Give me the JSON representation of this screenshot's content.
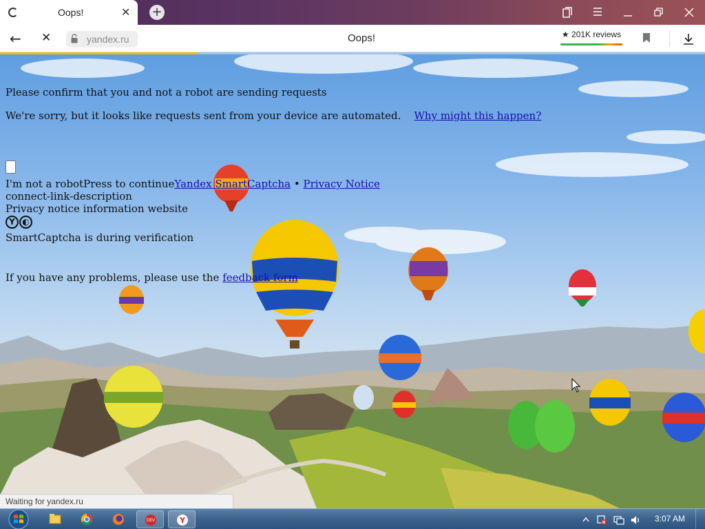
{
  "browser": {
    "tab": {
      "title": "Oops!"
    },
    "address": {
      "url": "yandex.ru"
    },
    "page_title": "Oops!",
    "reviews": {
      "label": "201K reviews",
      "icon": "star-icon"
    },
    "progress": 0.28
  },
  "captcha": {
    "heading": "Please confirm that you and not a robot are sending requests",
    "sorry_text": "We're sorry, but it looks like requests sent from your device are automated.",
    "why_link": "Why might this happen?",
    "checkbox_label": "I'm not a robot",
    "press_text": "Press to continue",
    "smartcaptcha_link": "Yandex SmartCaptcha",
    "separator": "•",
    "privacy_link": "Privacy Notice",
    "connect_desc": "connect-link-description",
    "privacy_info": "Privacy notice information website",
    "verification_text": "SmartCaptcha is during verification",
    "problems_text": "If you have any problems, please use the",
    "feedback_link": "feedback form"
  },
  "status_bar": {
    "text": "Waiting for yandex.ru"
  },
  "taskbar": {
    "apps": [
      "file-explorer-icon",
      "chrome-icon",
      "firefox-icon",
      "devcpp-icon",
      "yandex-browser-icon"
    ],
    "clock": "3:07 AM"
  }
}
